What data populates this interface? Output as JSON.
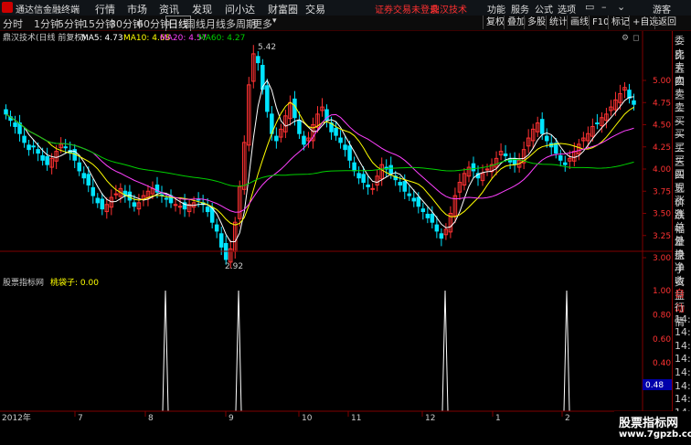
{
  "menubar": {
    "app_title": "通达信金融终端",
    "items": [
      "行情",
      "市场",
      "资讯",
      "发现",
      "问小达",
      "财富圈",
      "交易"
    ],
    "warning": "证券交易未登录",
    "stock": "鼎汉技术",
    "right_items": [
      "功能",
      "服务",
      "公式",
      "选项"
    ],
    "guest": "游客"
  },
  "periods": [
    "分时",
    "1分钟",
    "5分钟",
    "15分钟",
    "30分钟",
    "60分钟",
    "日线",
    "周线",
    "月线",
    "多周期",
    "更多"
  ],
  "active_period": "日线",
  "toolbar_buttons": [
    "复权",
    "叠加",
    "多股",
    "统计",
    "画线",
    "F10",
    "标记",
    "+自选",
    "返回"
  ],
  "main_panel": {
    "title": "鼎汉技术(日线 前复权)",
    "ma5_label": "MA5: 4.73",
    "ma10_label": "MA10: 4.68",
    "ma20_label": "MA20: 4.57",
    "ma60_label": "MA60: 4.27",
    "high_label": "5.42",
    "low_label": "2.92"
  },
  "indicator_panel": {
    "title": "股票指标网",
    "name": "桃袋子: 0.00",
    "current_value": "0.48"
  },
  "x_axis": {
    "year": "2012年",
    "months": [
      "7",
      "8",
      "9",
      "10",
      "11",
      "12",
      "1",
      "2"
    ]
  },
  "sidebar": [
    "委比",
    "卖五",
    "卖四",
    "卖三",
    "卖二",
    "卖一",
    "买一",
    "买二",
    "买三",
    "买四",
    "买五",
    "现价",
    "涨跌",
    "涨幅",
    "总量",
    "外盘",
    "换手",
    "净资",
    "收益",
    "自动",
    "行情",
    "14:5",
    "14:5",
    "14:5",
    "14:5",
    "14:5",
    "14:5",
    "14:5",
    "14:5",
    "14:5"
  ],
  "watermark": {
    "line1": "股票指标网",
    "line2": "www.7gpzb.com"
  },
  "colors": {
    "up": "#ff3232",
    "down": "#00e4ff",
    "ma5": "#ffffff",
    "ma10": "#ffff00",
    "ma20": "#ff40ff",
    "ma60": "#00d000",
    "frame": "#800000",
    "spike": "#ffffff"
  },
  "chart_data": {
    "type": "candlestick",
    "price_axis": [
      5.0,
      4.75,
      4.5,
      4.25,
      4.0,
      3.75,
      3.5,
      3.25,
      3.0
    ],
    "indicator_axis": [
      1.0,
      0.8,
      0.6,
      0.4,
      0.2
    ],
    "closes": [
      4.62,
      4.55,
      4.48,
      4.4,
      4.3,
      4.22,
      4.25,
      4.18,
      4.1,
      4.05,
      4.12,
      4.2,
      4.28,
      4.24,
      4.18,
      4.1,
      3.98,
      3.9,
      3.82,
      3.7,
      3.62,
      3.55,
      3.6,
      3.68,
      3.72,
      3.78,
      3.7,
      3.65,
      3.58,
      3.62,
      3.7,
      3.75,
      3.78,
      3.74,
      3.7,
      3.66,
      3.62,
      3.6,
      3.58,
      3.55,
      3.6,
      3.62,
      3.65,
      3.6,
      3.52,
      3.4,
      3.3,
      3.12,
      2.98,
      3.1,
      3.4,
      3.8,
      4.3,
      4.95,
      5.3,
      5.2,
      4.9,
      4.65,
      4.4,
      4.32,
      4.45,
      4.6,
      4.75,
      4.58,
      4.4,
      4.28,
      4.35,
      4.5,
      4.62,
      4.7,
      4.55,
      4.42,
      4.38,
      4.3,
      4.22,
      4.1,
      3.98,
      3.9,
      3.85,
      3.8,
      3.78,
      3.92,
      4.05,
      4.0,
      3.95,
      3.88,
      3.82,
      3.75,
      3.7,
      3.64,
      3.58,
      3.52,
      3.45,
      3.4,
      3.3,
      3.22,
      3.32,
      3.5,
      3.7,
      3.85,
      3.95,
      4.02,
      3.98,
      3.9,
      3.95,
      4.0,
      4.05,
      4.12,
      4.2,
      4.15,
      4.08,
      4.05,
      4.1,
      4.22,
      4.35,
      4.45,
      4.52,
      4.4,
      4.32,
      4.25,
      4.18,
      4.1,
      4.05,
      4.12,
      4.2,
      4.28,
      4.35,
      4.4,
      4.48,
      4.52,
      4.58,
      4.62,
      4.7,
      4.78,
      4.85,
      4.92,
      4.8,
      4.73
    ],
    "spike_positions": [
      50,
      70,
      145,
      270,
      420
    ]
  }
}
